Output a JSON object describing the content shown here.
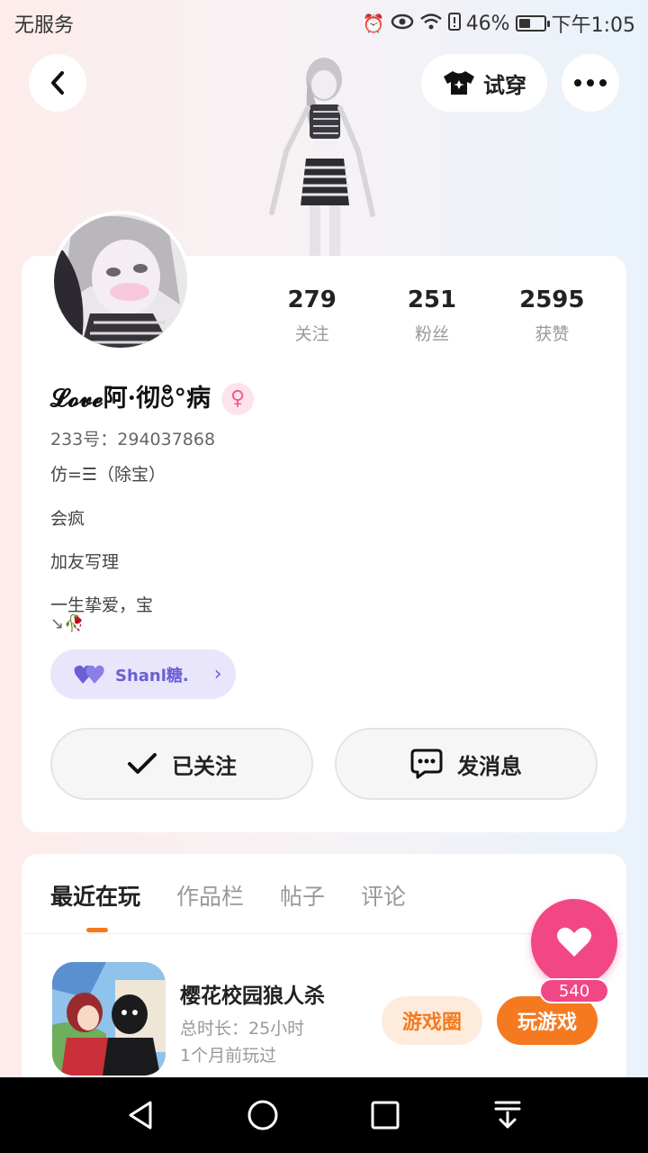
{
  "status_bar": {
    "carrier": "无服务",
    "battery": "46%",
    "battery_level": 0.46,
    "time": "下午1:05",
    "icons": [
      "alarm-icon",
      "eye-icon",
      "wifi-icon",
      "sim-alert-icon",
      "battery-icon"
    ]
  },
  "header": {
    "back_icon": "chevron-left-icon",
    "tryon_label": "试穿",
    "tryon_icon": "shirt-icon",
    "more_icon": "more-dots-icon"
  },
  "profile": {
    "stats": [
      {
        "value": "279",
        "label": "关注"
      },
      {
        "value": "251",
        "label": "粉丝"
      },
      {
        "value": "2595",
        "label": "获赞"
      }
    ],
    "username": "𝓛𝓸𝓿𝓮阿·彻ဗီ°病",
    "gender_icon": "female-icon",
    "uid": "233号：294037868",
    "bio": [
      "仿=☰（除宝）",
      "会疯",
      "加友写理",
      "一生挚爱，宝",
      "↘🥀"
    ],
    "couple": {
      "name": "Shanl糖.",
      "icon": "double-heart-icon"
    },
    "follow_label": "已关注",
    "message_label": "发消息"
  },
  "tabs": [
    "最近在玩",
    "作品栏",
    "帖子",
    "评论"
  ],
  "active_tab": 0,
  "recent_game": {
    "title": "樱花校园狼人杀",
    "playtime": "总时长：25小时",
    "last_played": "1个月前玩过",
    "circle_label": "游戏圈",
    "play_label": "玩游戏"
  },
  "like": {
    "count": "540"
  },
  "colors": {
    "accent": "#f57a1f",
    "like": "#f24785",
    "couple": "#6b5fd6"
  }
}
